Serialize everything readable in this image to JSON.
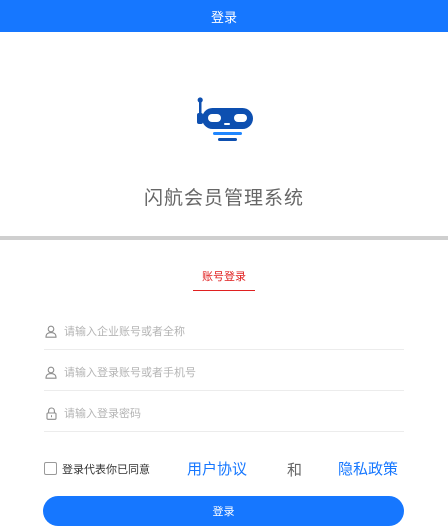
{
  "header": {
    "title": "登录"
  },
  "brand": {
    "app_name": "闪航会员管理系统",
    "logo_icon": "robot-logo-icon"
  },
  "tabs": [
    {
      "label": "账号登录",
      "active": true
    }
  ],
  "form": {
    "company": {
      "placeholder": "请输入企业账号或者全称",
      "value": "",
      "icon": "user-icon"
    },
    "account": {
      "placeholder": "请输入登录账号或者手机号",
      "value": "",
      "icon": "user-icon"
    },
    "password": {
      "placeholder": "请输入登录密码",
      "value": "",
      "icon": "lock-icon"
    }
  },
  "agreement": {
    "checked": false,
    "prefix": "登录代表你已同意",
    "user_agreement": "用户协议",
    "and": "和",
    "privacy_policy": "隐私政策"
  },
  "login_button": {
    "label": "登录"
  },
  "colors": {
    "primary": "#1677ff",
    "tab_active": "#e02020",
    "logo_dark": "#0d4fb0"
  }
}
